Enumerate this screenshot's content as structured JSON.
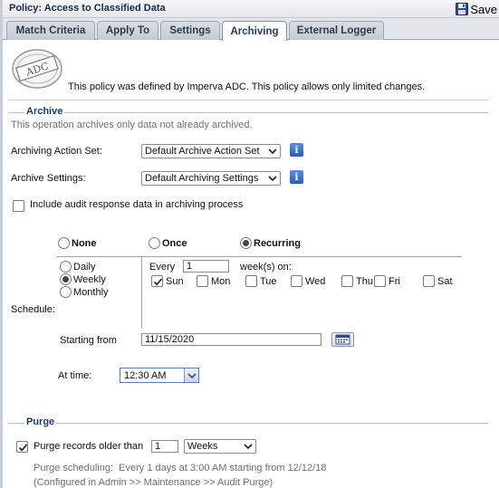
{
  "window": {
    "title": "Policy: Access to Classified Data",
    "save_label": "Save"
  },
  "tabs": [
    {
      "label": "Match Criteria",
      "active": false
    },
    {
      "label": "Apply To",
      "active": false
    },
    {
      "label": "Settings",
      "active": false
    },
    {
      "label": "Archiving",
      "active": true
    },
    {
      "label": "External Logger",
      "active": false
    }
  ],
  "banner": {
    "stamp_text": "ADC",
    "text": "This policy was defined by Imperva ADC. This policy allows only limited changes."
  },
  "archive": {
    "title": "Archive",
    "note": "This operation archives only data not already archived.",
    "action_set_label": "Archiving Action Set:",
    "action_set_value": "Default Archive Action Set",
    "settings_label": "Archive Settings:",
    "settings_value": "Default Archiving Settings",
    "include_audit_label": "Include audit response data in archiving process",
    "include_audit_checked": false
  },
  "schedule": {
    "label": "Schedule:",
    "modes": {
      "none": "None",
      "once": "Once",
      "recurring": "Recurring",
      "selected": "Recurring"
    },
    "freq": {
      "daily": "Daily",
      "weekly": "Weekly",
      "monthly": "Monthly",
      "selected": "Weekly"
    },
    "every_label": "Every",
    "every_value": "1",
    "weeks_on_label": "week(s) on:",
    "days": [
      {
        "label": "Sun",
        "checked": true
      },
      {
        "label": "Mon",
        "checked": false
      },
      {
        "label": "Tue",
        "checked": false
      },
      {
        "label": "Wed",
        "checked": false
      },
      {
        "label": "Thu",
        "checked": false
      },
      {
        "label": "Fri",
        "checked": false
      },
      {
        "label": "Sat",
        "checked": false
      }
    ],
    "starting_from_label": "Starting from",
    "starting_from_value": "11/15/2020",
    "at_time_label": "At time:",
    "at_time_value": "12:30 AM"
  },
  "purge": {
    "title": "Purge",
    "checkbox_label": "Purge records older than",
    "checked": true,
    "amount": "1",
    "unit": "Weeks",
    "scheduling_line": "Purge scheduling:  Every 1 days at 3:00 AM starting from 12/12/18",
    "config_line": "(Configured in Admin >> Maintenance >> Audit Purge)"
  },
  "colors": {
    "accent": "#1e3c6a",
    "tab_bg": "#c4cbd4",
    "info_blue": "#2a5fb0"
  }
}
